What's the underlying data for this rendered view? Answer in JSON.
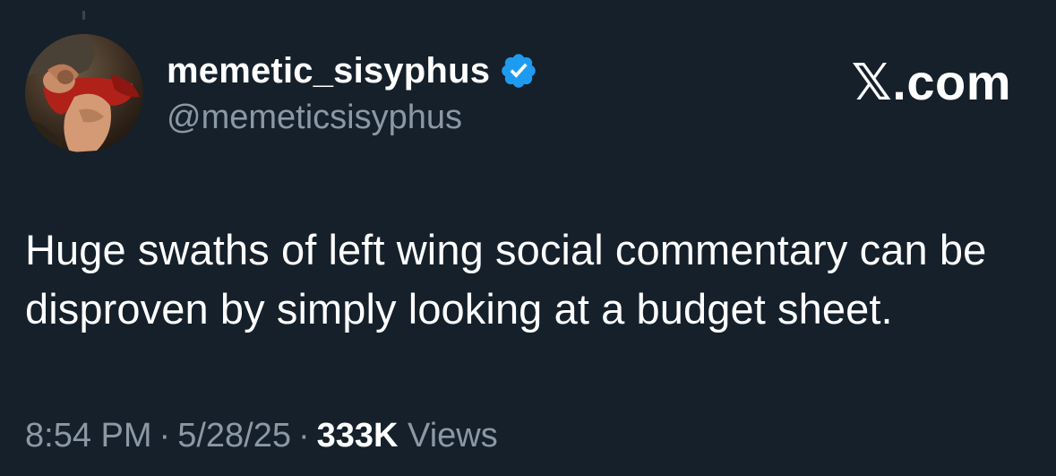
{
  "tweet": {
    "display_name": "memetic_sisyphus",
    "handle": "@memeticsisyphus",
    "verified_icon": "verified-badge-icon",
    "brand": "𝕏.com",
    "text": "Huge swaths of left wing social commentary can be disproven by simply looking at a budget sheet.",
    "time": "8:54 PM",
    "separator": "·",
    "date": "5/28/25",
    "views_count": "333K",
    "views_label": "Views"
  },
  "colors": {
    "background": "#15202b",
    "text_primary": "#ffffff",
    "text_secondary": "#8b98a5",
    "verified_blue": "#1d9bf0"
  }
}
